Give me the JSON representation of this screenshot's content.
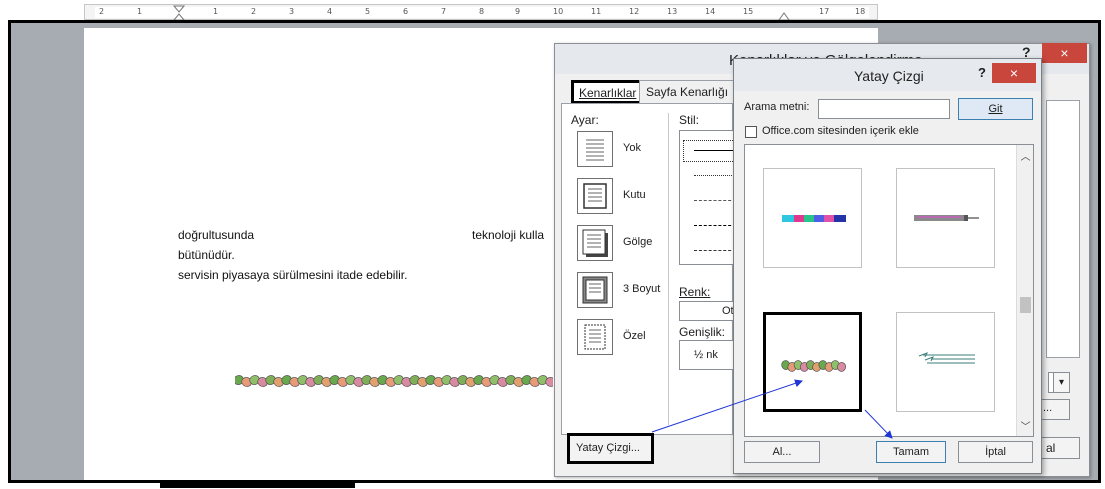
{
  "ruler": {
    "numbers": [
      "2",
      "1",
      "1",
      "2",
      "3",
      "4",
      "5",
      "6",
      "7",
      "8",
      "9",
      "10",
      "11",
      "12",
      "13",
      "14",
      "15",
      "17",
      "18"
    ]
  },
  "document": {
    "line1_left": "doğrultusunda",
    "line1_right": "teknoloji kulla",
    "line2": "bütünüdür.",
    "line3": "servisin piyasaya sürülmesini itade edebilir."
  },
  "borders_dialog": {
    "title": "Kenarlıklar ve Gölgelendirme",
    "help": "?",
    "close": "×",
    "tabs": [
      "Kenarlıklar",
      "Sayfa Kenarlığı"
    ],
    "setting_label": "Ayar:",
    "settings": [
      "Yok",
      "Kutu",
      "Gölge",
      "3 Boyut",
      "Özel"
    ],
    "style_label": "Stil:",
    "color_label": "Renk:",
    "color_value": "Ot",
    "width_label": "Genişlik:",
    "width_value": "½ nk",
    "horizontal_line_button": "Yatay Çizgi...",
    "right_button1": "...",
    "right_button2": "al"
  },
  "horizontal_line_dialog": {
    "title": "Yatay Çizgi",
    "help": "?",
    "close": "×",
    "search_label": "Arama metni:",
    "search_value": "",
    "go_button": "Git",
    "checkbox_label": "Office.com sitesinden içerik ekle",
    "checkbox_checked": false,
    "import_button": "Al...",
    "ok_button": "Tamam",
    "cancel_button": "İptal"
  },
  "colors": {
    "close_red": "#c9463d",
    "annotation_arrow": "#1f35d6",
    "highlight": "#000000"
  }
}
